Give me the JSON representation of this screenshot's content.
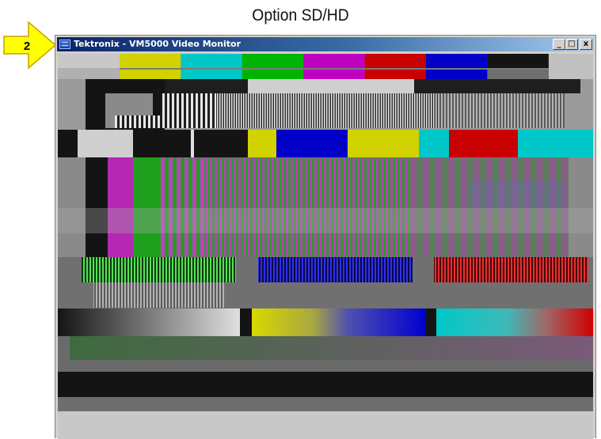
{
  "caption": {
    "text": "Option SD/HD"
  },
  "callout": {
    "number": "2",
    "color": "#ffff00"
  },
  "window": {
    "title": "Tektronix - VM5000 Video Monitor",
    "buttons": {
      "minimize": "_",
      "maximize": "□",
      "close": "x"
    }
  },
  "test_pattern": {
    "colors": {
      "yellow": "#d2d200",
      "cyan": "#00c8c8",
      "green": "#00b400",
      "magenta": "#c000c0",
      "red": "#c80000",
      "blue": "#0000c8",
      "white": "#d4d4d4",
      "black": "#141414",
      "gray": "#6e6e6e"
    }
  }
}
